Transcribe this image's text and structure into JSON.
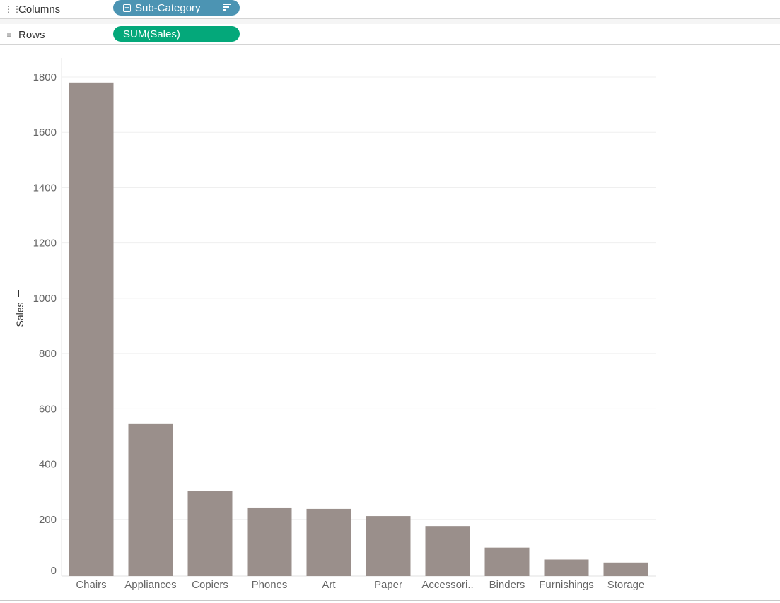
{
  "shelves": {
    "columns": {
      "label": "Columns",
      "icon": "columns-icon",
      "pill": "Sub-Category",
      "pill_color": "#4c94b3"
    },
    "rows": {
      "label": "Rows",
      "icon": "rows-icon",
      "pill": "SUM(Sales)",
      "pill_color": "#04a87a"
    }
  },
  "chart_data": {
    "type": "bar",
    "categories": [
      "Chairs",
      "Appliances",
      "Copiers",
      "Phones",
      "Art",
      "Paper",
      "Accessori..",
      "Binders",
      "Furnishings",
      "Storage"
    ],
    "values": [
      1780,
      545,
      302,
      243,
      238,
      212,
      176,
      98,
      55,
      44
    ],
    "ylabel": "Sales",
    "ylim": [
      0,
      1800
    ],
    "yticks": [
      0,
      200,
      400,
      600,
      800,
      1000,
      1200,
      1400,
      1600,
      1800
    ],
    "bar_color": "#9a8f8b",
    "grid": true
  }
}
